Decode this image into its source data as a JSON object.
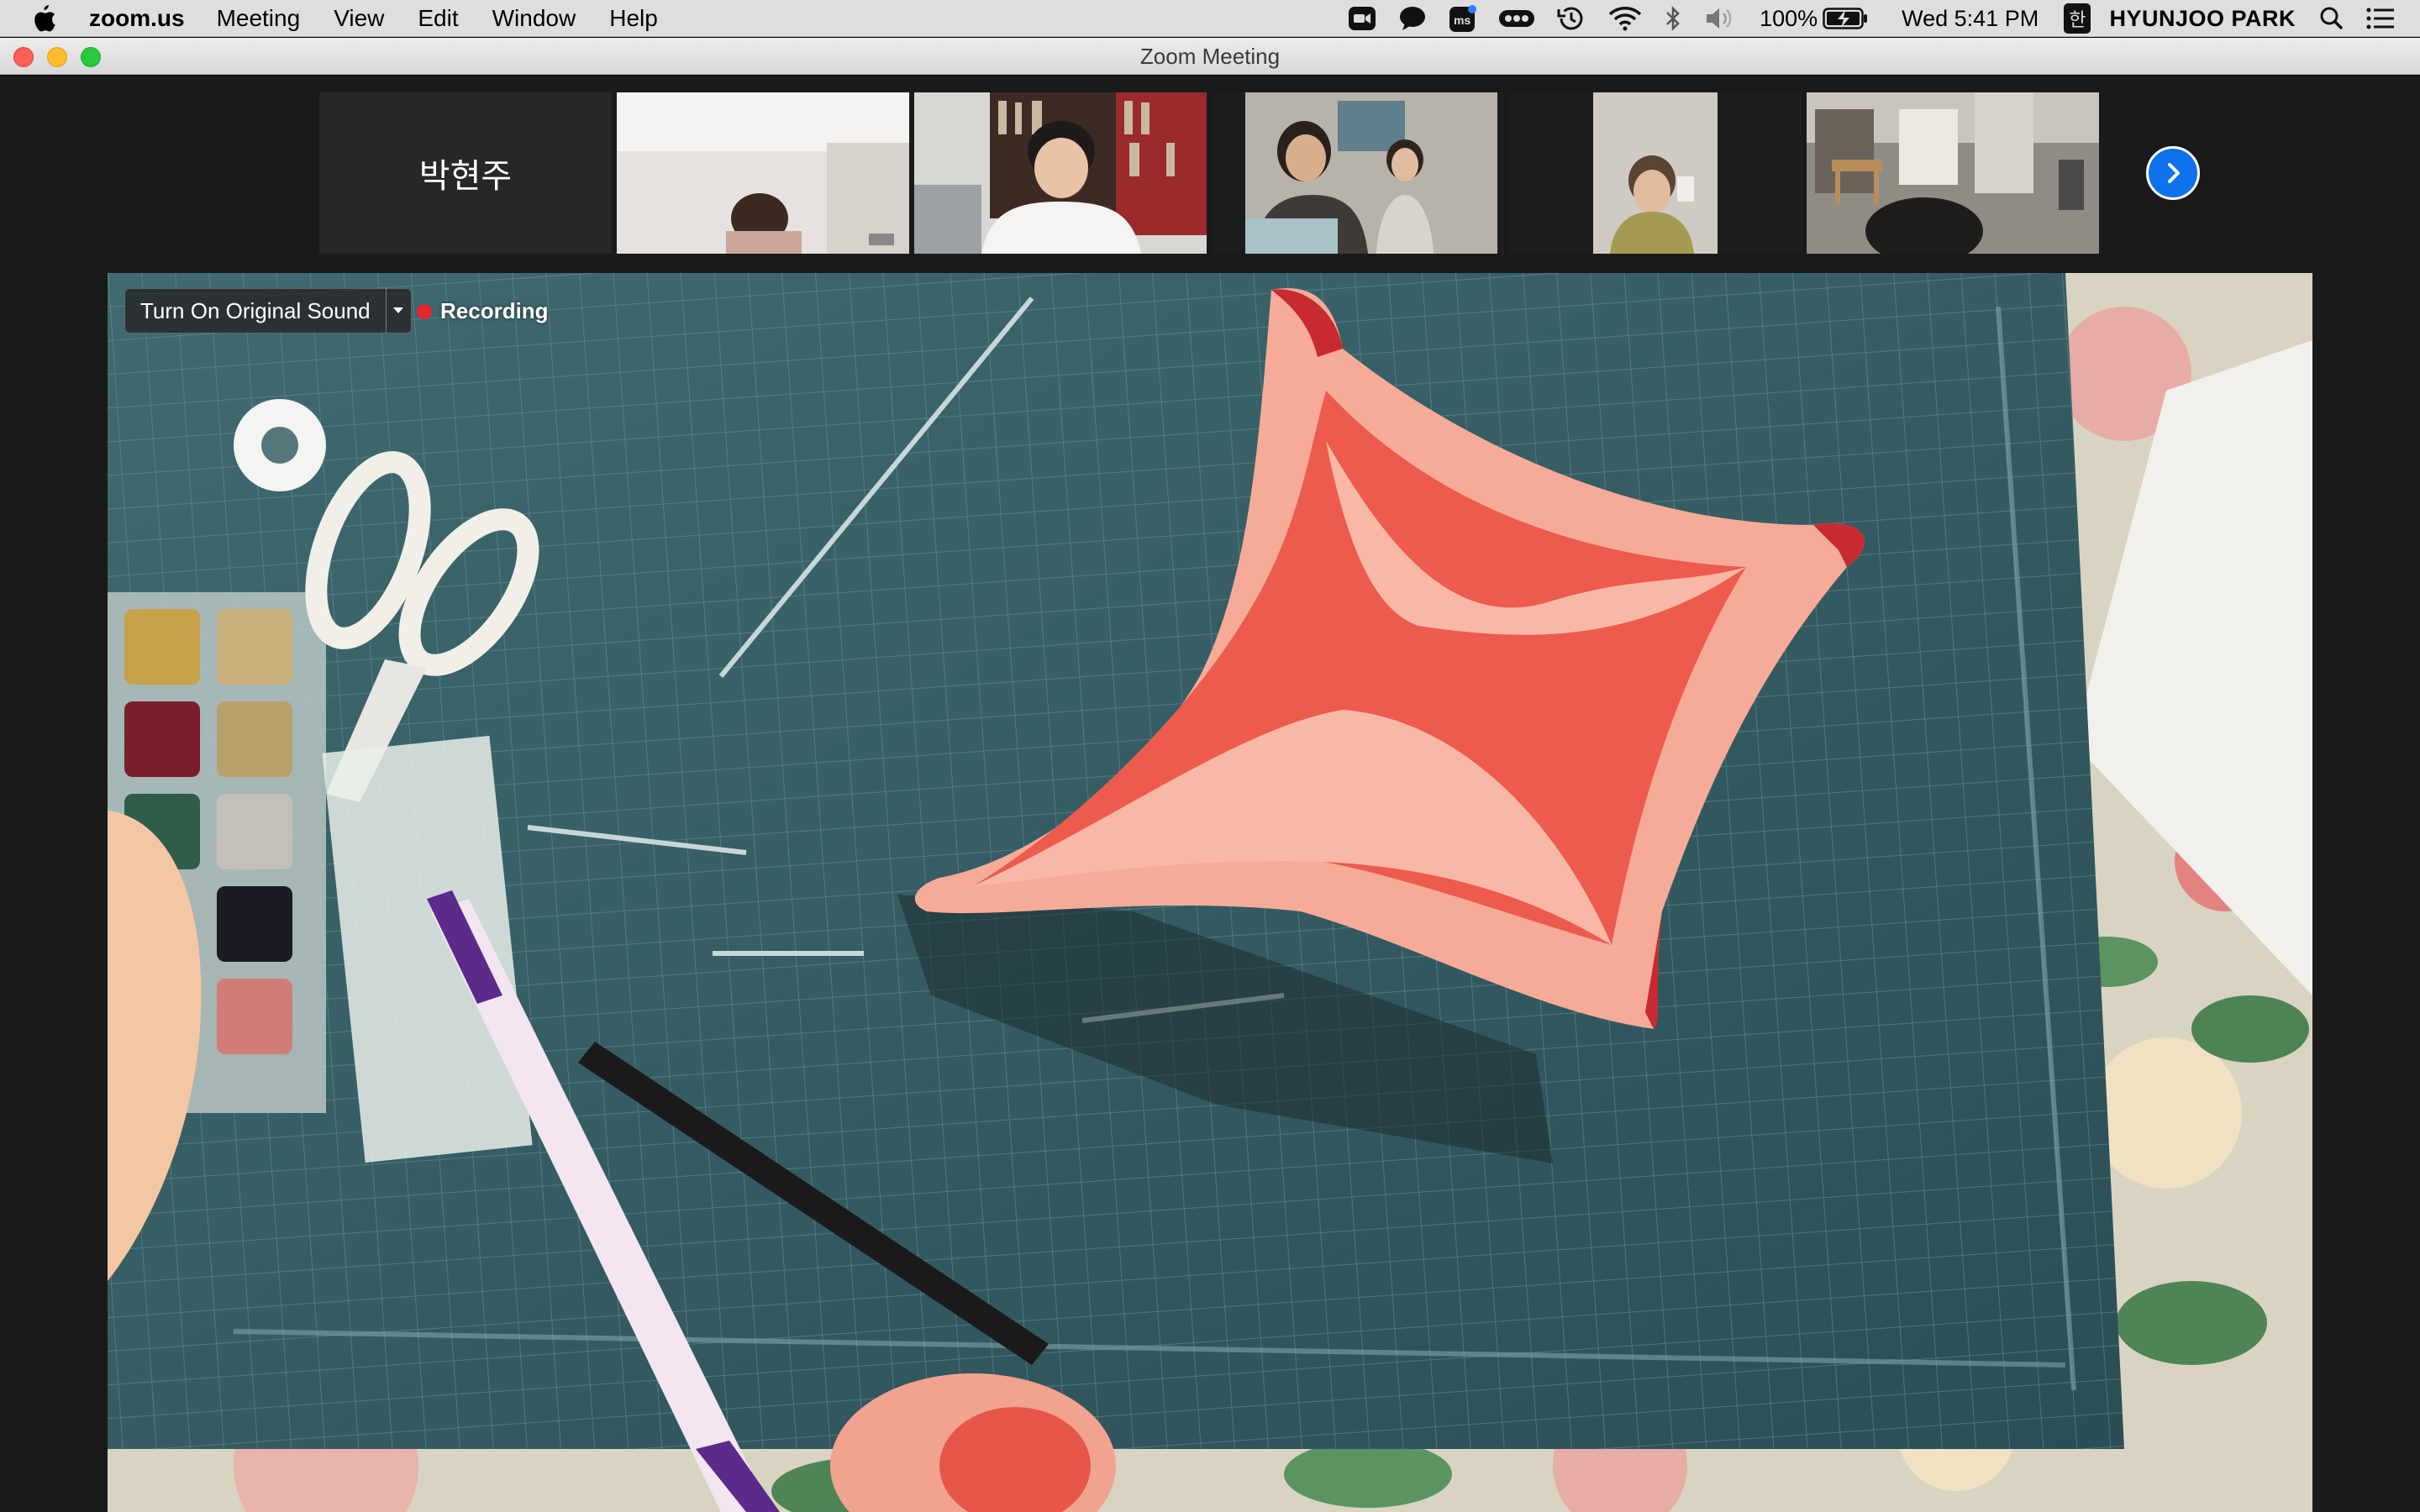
{
  "menubar": {
    "app_name": "zoom.us",
    "menus": [
      "Meeting",
      "View",
      "Edit",
      "Window",
      "Help"
    ],
    "battery": "100%",
    "clock": "Wed 5:41 PM",
    "input_source": "한",
    "user": "HYUNJOO PARK",
    "icons": [
      "zoom-icon",
      "messages-icon",
      "ms-icon",
      "more-dots-icon",
      "time-machine-icon",
      "wifi-icon",
      "bluetooth-icon",
      "volume-icon",
      "battery-icon",
      "spotlight-icon",
      "control-center-icon"
    ]
  },
  "window": {
    "title": "Zoom Meeting"
  },
  "participants": {
    "name_tile": "박현주",
    "video_tile_count": 6
  },
  "main_video": {
    "original_sound_label": "Turn On Original Sound",
    "recording_label": "Recording"
  },
  "colors": {
    "zoom_blue": "#0e72ed",
    "recording_red": "#e0282e"
  }
}
